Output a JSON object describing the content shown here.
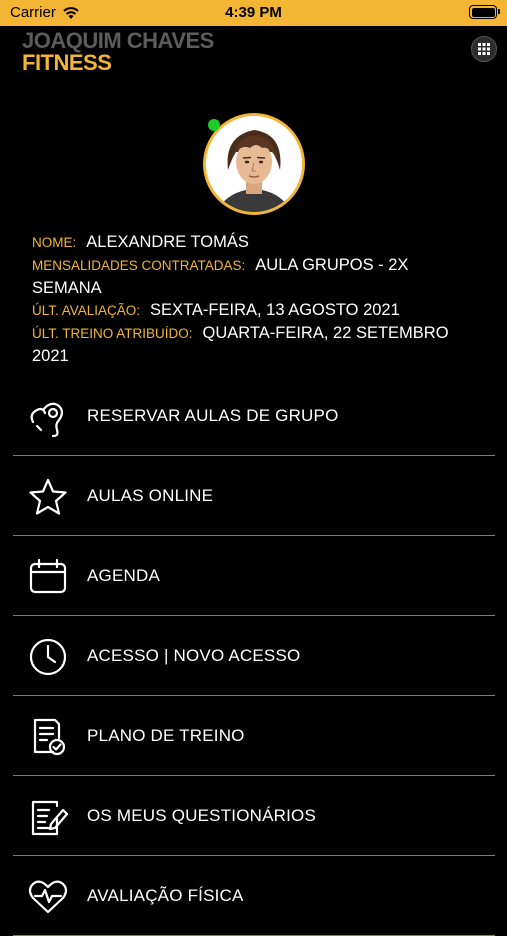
{
  "status_bar": {
    "carrier": "Carrier",
    "time": "4:39 PM"
  },
  "brand": {
    "line1": "JOAQUIM CHAVES",
    "line2": "FITNESS"
  },
  "profile": {
    "nome_label": "NOME:",
    "nome_value": "ALEXANDRE TOMÁS",
    "mensalidades_label": "MENSALIDADES CONTRATADAS:",
    "mensalidades_value": "AULA GRUPOS - 2X SEMANA",
    "avaliacao_label": "ÚLT. AVALIAÇÃO:",
    "avaliacao_value": "SEXTA-FEIRA, 13 AGOSTO 2021",
    "treino_label": "ÚLT. TREINO ATRIBUÍDO:",
    "treino_value": "QUARTA-FEIRA, 22 SETEMBRO 2021"
  },
  "menu": {
    "items": [
      {
        "label": "RESERVAR AULAS DE GRUPO",
        "icon": "whistle-icon"
      },
      {
        "label": "AULAS ONLINE",
        "icon": "star-icon"
      },
      {
        "label": "AGENDA",
        "icon": "calendar-icon"
      },
      {
        "label": "ACESSO | NOVO ACESSO",
        "icon": "clock-icon"
      },
      {
        "label": "PLANO DE TREINO",
        "icon": "training-plan-icon"
      },
      {
        "label": "OS MEUS QUESTIONÁRIOS",
        "icon": "questionnaire-icon"
      },
      {
        "label": "AVALIAÇÃO FÍSICA",
        "icon": "heart-rate-icon"
      }
    ]
  },
  "colors": {
    "accent": "#f3b533",
    "background": "#000000",
    "online": "#1ecb2a"
  }
}
